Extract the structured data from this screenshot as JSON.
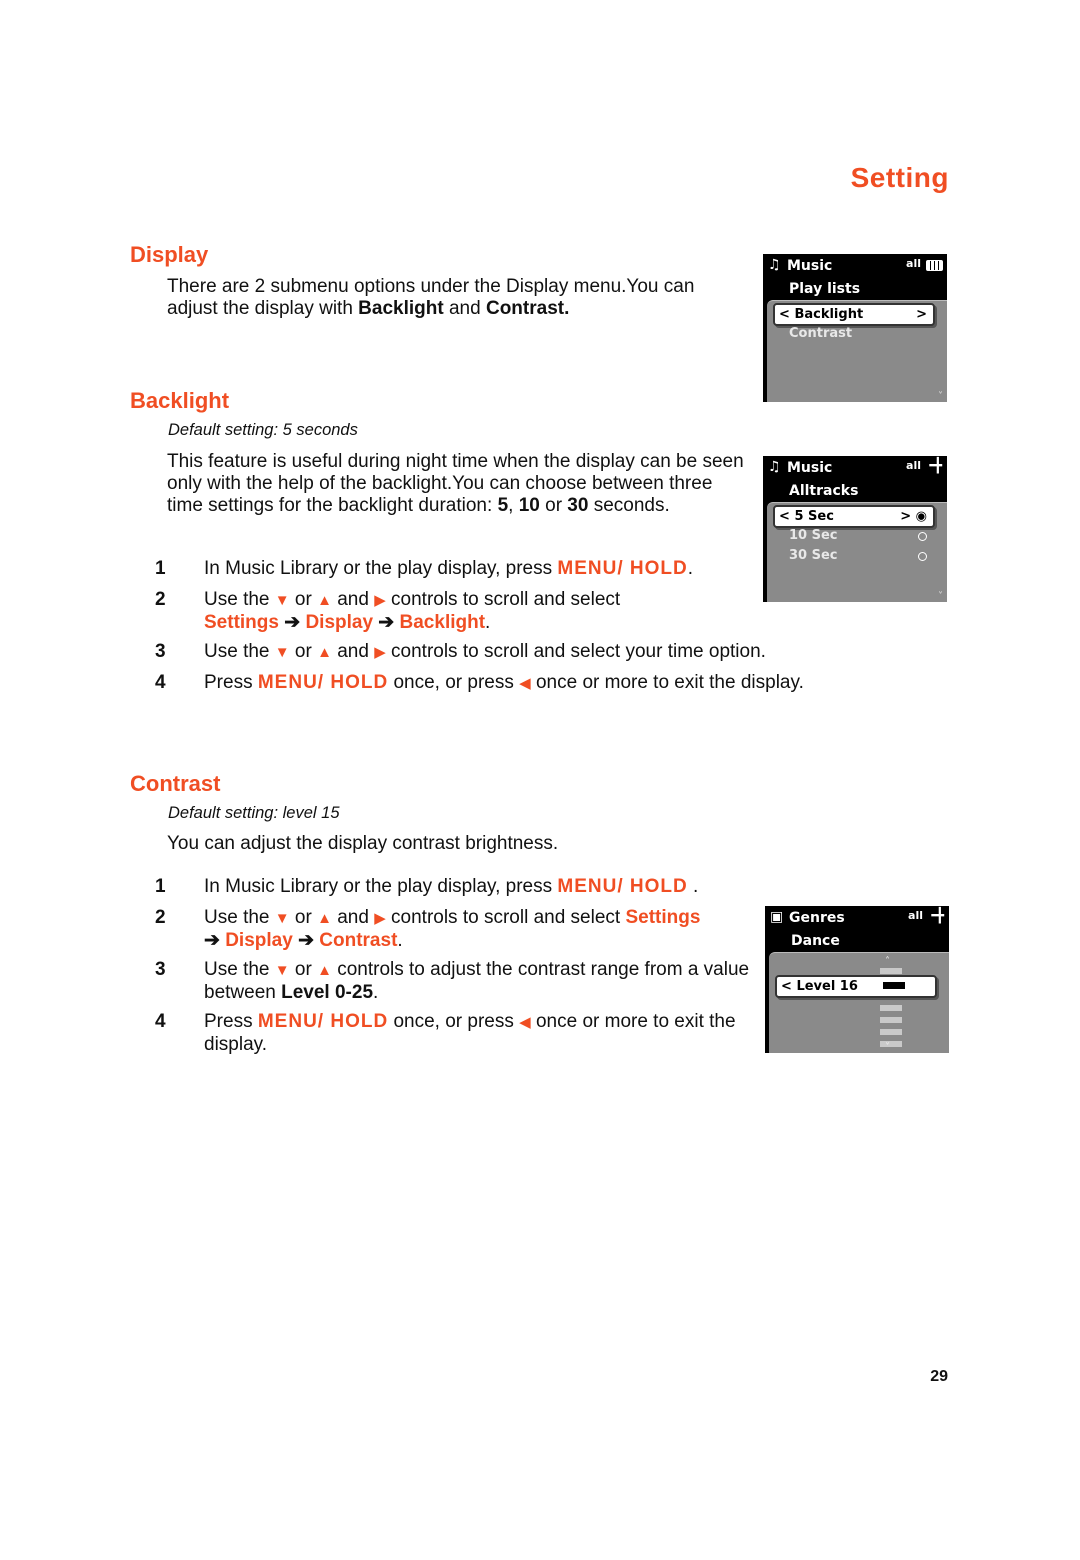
{
  "header": {
    "section_title": "Setting"
  },
  "display": {
    "heading": "Display",
    "para_pre": "There are 2 submenu options under the Display menu.You can adjust the display with ",
    "para_b1": "Backlight",
    "para_mid": " and ",
    "para_b2": "Contrast."
  },
  "backlight": {
    "heading": "Backlight",
    "default": "Default setting: 5 seconds",
    "para_pre": "This feature is useful during night time when the display can be seen only with the help of the backlight.You can choose between three time settings for the backlight duration: ",
    "v1": "5",
    "sep1": ", ",
    "v2": "10",
    "sep2": " or ",
    "v3": "30",
    "para_post": " seconds.",
    "steps": [
      {
        "num": "1",
        "pre": "In Music Library or the play display, press ",
        "kw": "MENU/ HOLD",
        "post": "."
      },
      {
        "num": "2",
        "pre": "Use the ",
        "down": "▼",
        "or": " or ",
        "up": "▲",
        "and": " and ",
        "right": "▶",
        "post": " controls to scroll and select",
        "path1": "Settings",
        "arrow": " ➔ ",
        "path2": "Display",
        "path3": "Backlight",
        "end": "."
      },
      {
        "num": "3",
        "pre": "Use the ",
        "down": "▼",
        "or": " or ",
        "up": "▲",
        "and": " and ",
        "right": "▶",
        "post": " controls to scroll and select your time option."
      },
      {
        "num": "4",
        "pre": "Press ",
        "kw": "MENU/ HOLD",
        "mid": " once, or press ",
        "left": "◀",
        "post": " once or more to exit the display."
      }
    ]
  },
  "contrast": {
    "heading": "Contrast",
    "default": "Default setting: level 15",
    "para": "You can adjust the display contrast brightness.",
    "steps": [
      {
        "num": "1",
        "pre": "In Music Library or the play display, press ",
        "kw": "MENU/ HOLD",
        "post": " ."
      },
      {
        "num": "2",
        "pre": "Use the ",
        "down": "▼",
        "or": " or ",
        "up": "▲",
        "and": " and ",
        "right": "▶",
        "post": " controls to scroll and select ",
        "path1": "Settings",
        "arrow": "➔ ",
        "path2": "Display",
        "arrow2": " ➔ ",
        "path3": "Contrast",
        "end": "."
      },
      {
        "num": "3",
        "pre": "Use the ",
        "down": "▼",
        "or": " or ",
        "up": "▲",
        "post": " controls to adjust the contrast range from a value between ",
        "b": "Level 0-25",
        "end": "."
      },
      {
        "num": "4",
        "pre": "Press ",
        "kw": "MENU/ HOLD",
        "mid": " once, or press ",
        "left": "◀",
        "post": " once or more to exit the display."
      }
    ]
  },
  "screens": {
    "display_menu": {
      "title": "Music",
      "subtitle": "Play lists",
      "selected": "Backlight",
      "items": [
        "Contrast"
      ]
    },
    "backlight_menu": {
      "title": "Music",
      "subtitle": "Alltracks",
      "selected": "5 Sec",
      "items": [
        "10 Sec",
        "30 Sec"
      ]
    },
    "contrast_menu": {
      "title": "Genres",
      "subtitle": "Dance",
      "selected": "Level 16",
      "level_fraction": 0.64
    },
    "icons": {
      "left": "<",
      "right": ">",
      "repeat": "all",
      "down": "˅",
      "up": "˄"
    }
  },
  "footer": {
    "page_number": "29"
  }
}
